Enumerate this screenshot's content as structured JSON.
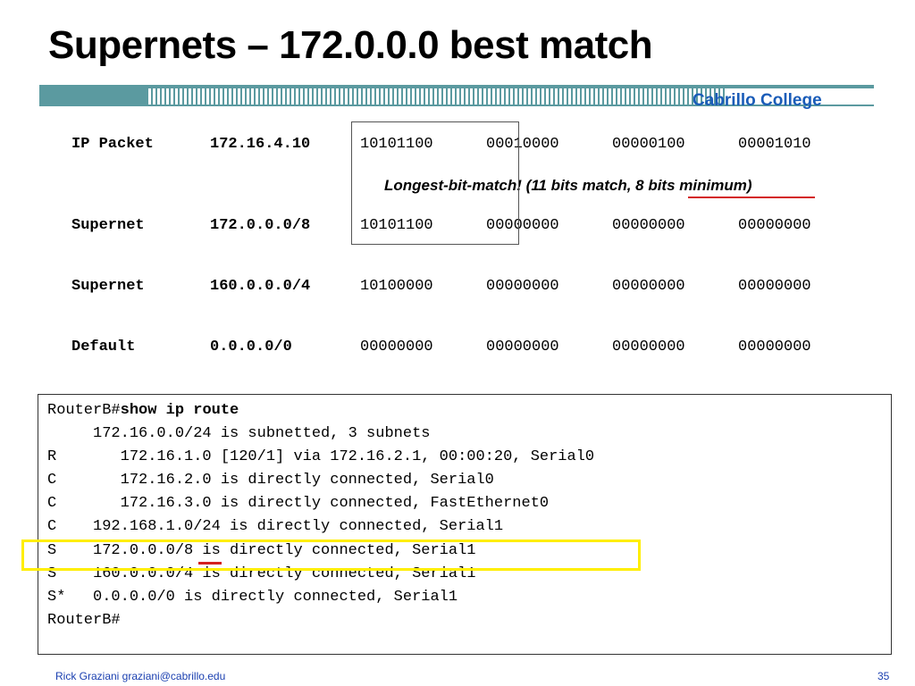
{
  "slide": {
    "title": "Supernets – 172.0.0.0 best match",
    "college": "Cabrillo College"
  },
  "rows": [
    {
      "label": "IP Packet",
      "address": "172.16.4.10",
      "bytes": [
        "10101100",
        "00010000",
        "00000100",
        "00001010"
      ]
    },
    {
      "label": "Supernet",
      "address": "172.0.0.0/8",
      "bytes": [
        "10101100",
        "00000000",
        "00000000",
        "00000000"
      ]
    },
    {
      "label": "Supernet",
      "address": "160.0.0.0/4",
      "bytes": [
        "10100000",
        "00000000",
        "00000000",
        "00000000"
      ]
    },
    {
      "label": "Default",
      "address": "0.0.0.0/0",
      "bytes": [
        "00000000",
        "00000000",
        "00000000",
        "00000000"
      ]
    }
  ],
  "note": "Longest-bit-match!   (11 bits match, 8 bits minimum)",
  "terminal": {
    "prompt": "RouterB#",
    "command": "show ip route",
    "lines": [
      "     172.16.0.0/24 is subnetted, 3 subnets",
      "R       172.16.1.0 [120/1] via 172.16.2.1, 00:00:20, Serial0",
      "C       172.16.2.0 is directly connected, Serial0",
      "C       172.16.3.0 is directly connected, FastEthernet0",
      "C    192.168.1.0/24 is directly connected, Serial1",
      "S    172.0.0.0/8 is directly connected, Serial1",
      "S    160.0.0.0/4 is directly connected, Serial1",
      "S*   0.0.0.0/0 is directly connected, Serial1",
      "RouterB#"
    ]
  },
  "footer": {
    "author": "Rick Graziani  graziani@cabrillo.edu",
    "page": "35"
  },
  "colors": {
    "accent_bar": "#5b9aa0",
    "college_blue": "#1a5cb8",
    "highlight_yellow": "#ffee00",
    "underline_red": "#d42020"
  }
}
